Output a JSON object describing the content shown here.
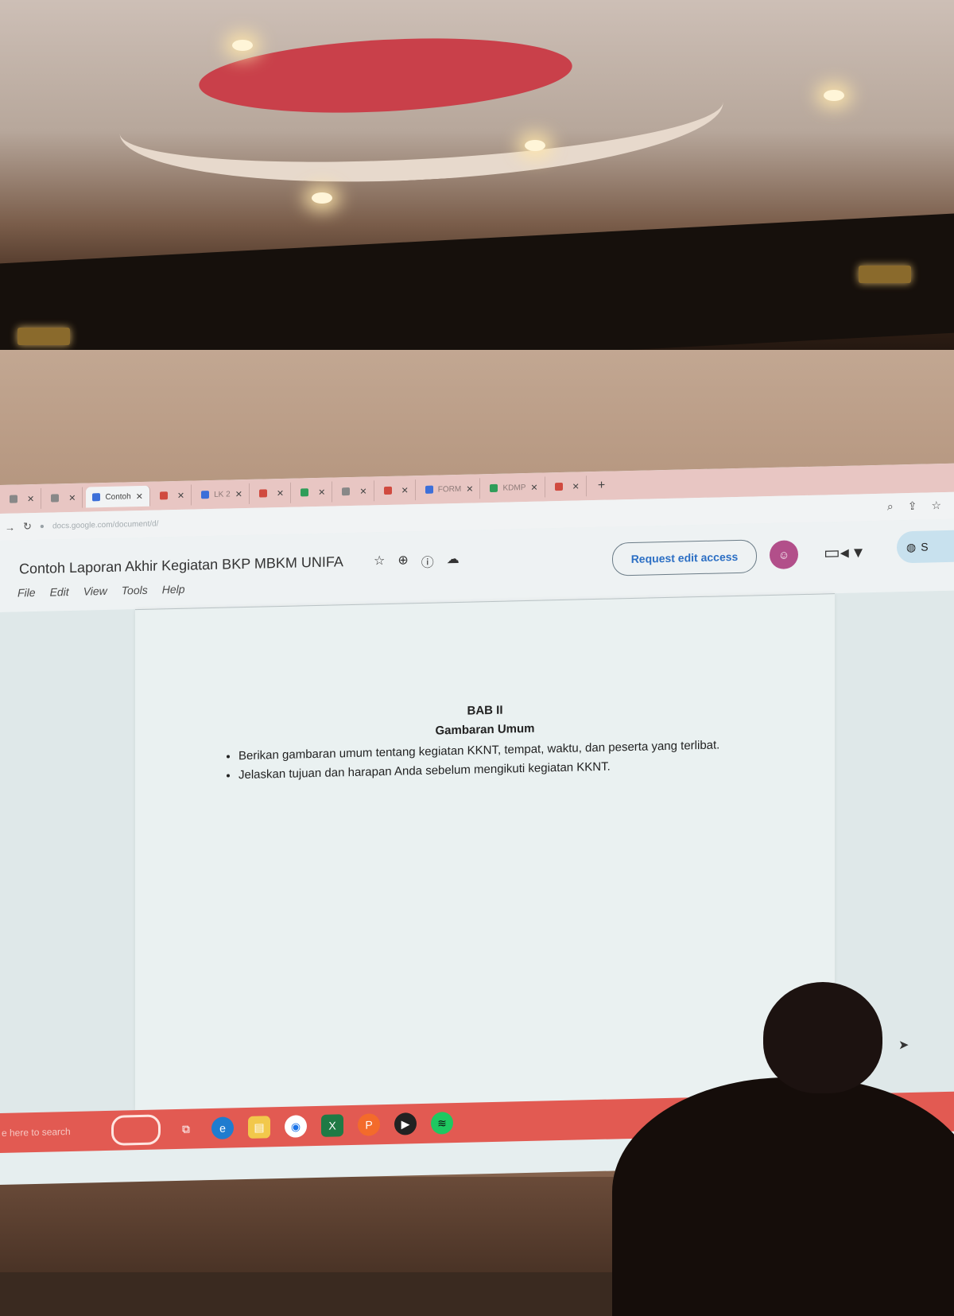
{
  "browser": {
    "tabs": [
      {
        "label": "",
        "icon": "gray-tab-icon"
      },
      {
        "label": "",
        "icon": "gray-tab-icon"
      },
      {
        "label": "Contoh",
        "icon": "docs-icon",
        "active": true
      },
      {
        "label": "",
        "icon": "youtube-icon"
      },
      {
        "label": "LK 2",
        "icon": "docs-icon"
      },
      {
        "label": "",
        "icon": "youtube-icon"
      },
      {
        "label": "",
        "icon": "drive-icon"
      },
      {
        "label": "",
        "icon": "gray-tab-icon"
      },
      {
        "label": "",
        "icon": "gmail-icon"
      },
      {
        "label": "FORM",
        "icon": "forms-icon"
      },
      {
        "label": "KDMP",
        "icon": "sheets-icon"
      },
      {
        "label": "",
        "icon": "youtube-icon"
      }
    ],
    "new_tab_symbol": "+",
    "url": "docs.google.com/document/d/"
  },
  "doc": {
    "title": "Contoh Laporan Akhir Kegiatan BKP MBKM UNIFA",
    "menu": [
      "File",
      "Edit",
      "View",
      "Tools",
      "Help"
    ],
    "request_edit_label": "Request edit access",
    "share_label": "S",
    "content": {
      "heading": "BAB II",
      "subheading": "Gambaran Umum",
      "bullets": [
        "Berikan gambaran umum tentang kegiatan KKNT, tempat, waktu, dan peserta yang terlibat.",
        "Jelaskan tujuan dan harapan Anda sebelum mengikuti kegiatan KKNT."
      ]
    }
  },
  "taskbar": {
    "search_placeholder": "e here to search",
    "apps": [
      "copilot-icon",
      "task-view-icon",
      "edge-icon",
      "file-explorer-icon",
      "chrome-icon",
      "excel-icon",
      "powerpoint-icon",
      "media-player-icon",
      "spotify-icon"
    ]
  },
  "colors": {
    "tabbar": "#e8c6c3",
    "taskbar": "#e25a52",
    "request_edit_text": "#2c6fc4",
    "avatar": "#b24f8a"
  }
}
